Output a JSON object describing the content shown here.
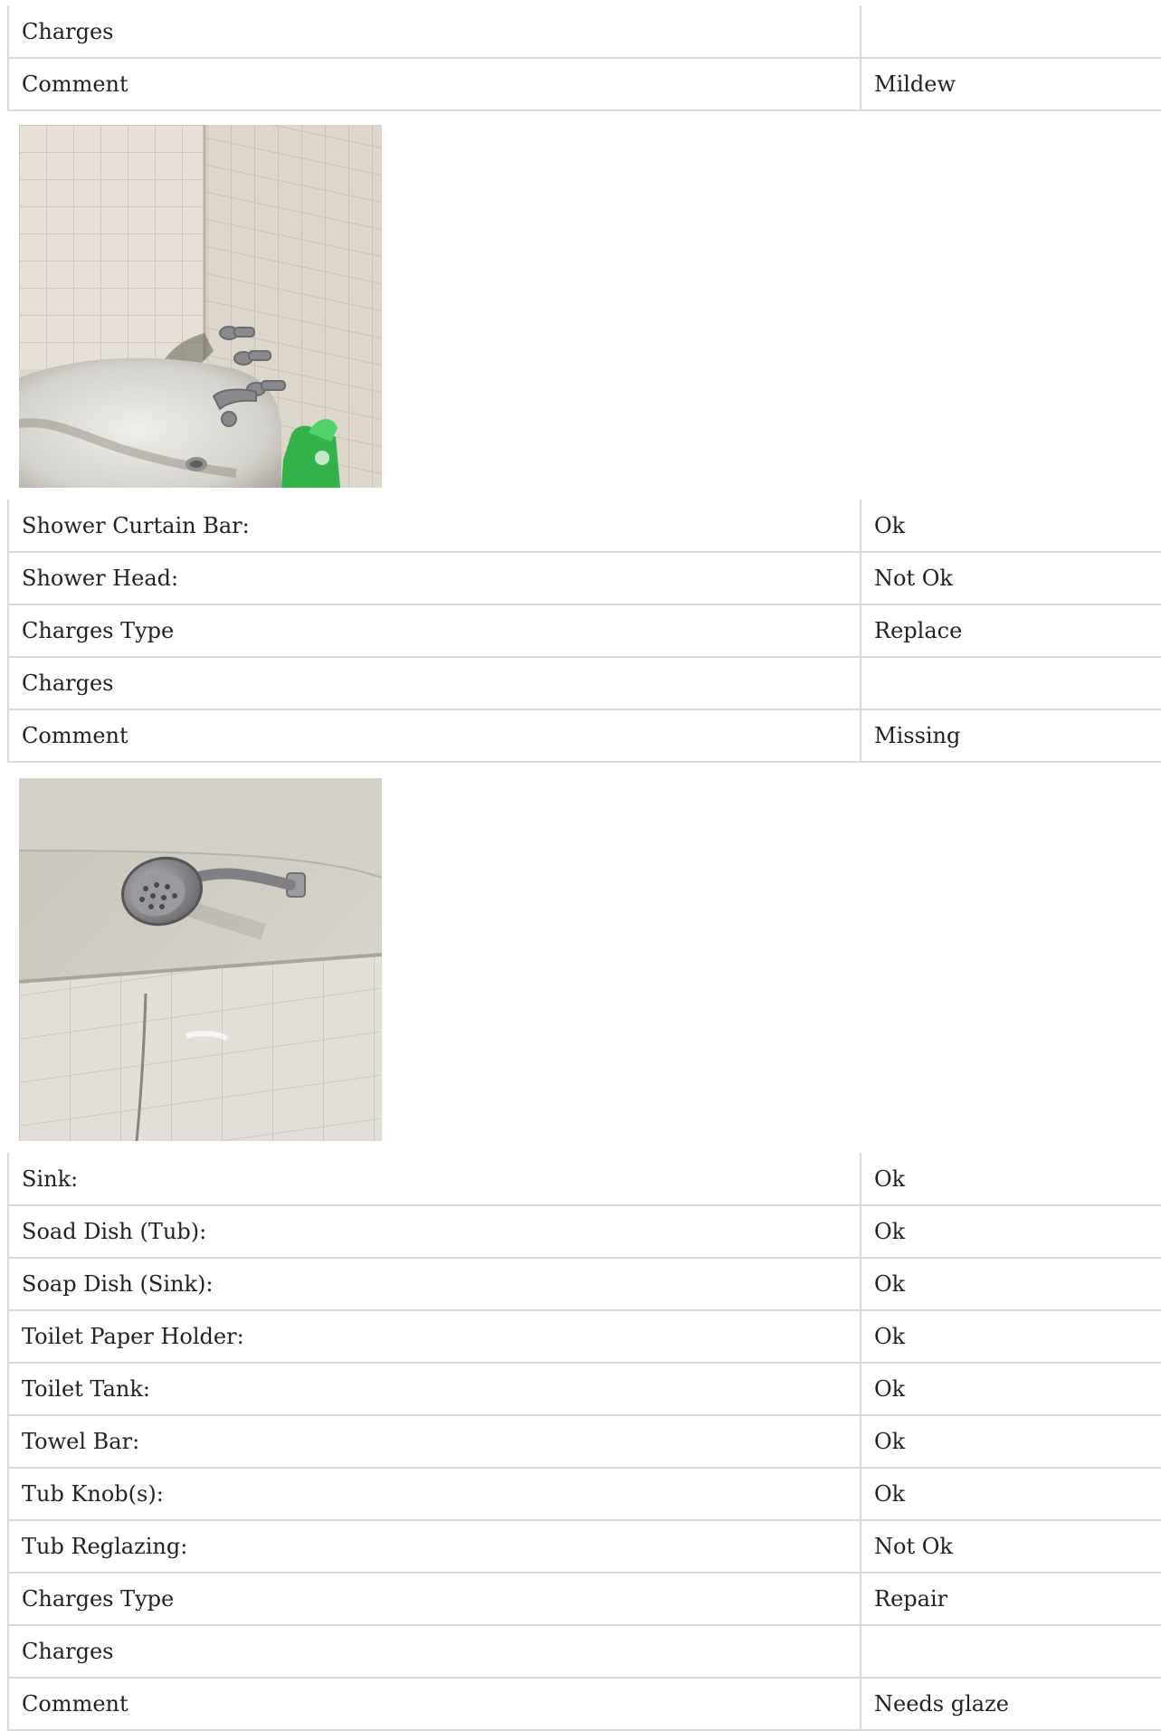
{
  "section_top": {
    "rows": [
      {
        "label": "Charges",
        "value": ""
      },
      {
        "label": "Comment",
        "value": "Mildew"
      }
    ]
  },
  "section_shower": {
    "rows": [
      {
        "label": "Shower Curtain Bar:",
        "value": "Ok"
      },
      {
        "label": "Shower Head:",
        "value": "Not Ok"
      },
      {
        "label": "Charges Type",
        "value": "Replace"
      },
      {
        "label": "Charges",
        "value": ""
      },
      {
        "label": "Comment",
        "value": "Missing"
      }
    ]
  },
  "section_fixtures": {
    "rows": [
      {
        "label": "Sink:",
        "value": "Ok"
      },
      {
        "label": "Soad Dish (Tub):",
        "value": "Ok"
      },
      {
        "label": "Soap Dish (Sink):",
        "value": "Ok"
      },
      {
        "label": "Toilet Paper Holder:",
        "value": "Ok"
      },
      {
        "label": "Toilet Tank:",
        "value": "Ok"
      },
      {
        "label": "Towel Bar:",
        "value": "Ok"
      },
      {
        "label": "Tub Knob(s):",
        "value": "Ok"
      },
      {
        "label": "Tub Reglazing:",
        "value": "Not Ok"
      },
      {
        "label": "Charges Type",
        "value": "Repair"
      },
      {
        "label": "Charges",
        "value": ""
      },
      {
        "label": "Comment",
        "value": "Needs glaze"
      }
    ]
  },
  "photos": {
    "tub_photo": "bathtub-mildew-photo",
    "shower_photo": "shower-head-photo"
  }
}
